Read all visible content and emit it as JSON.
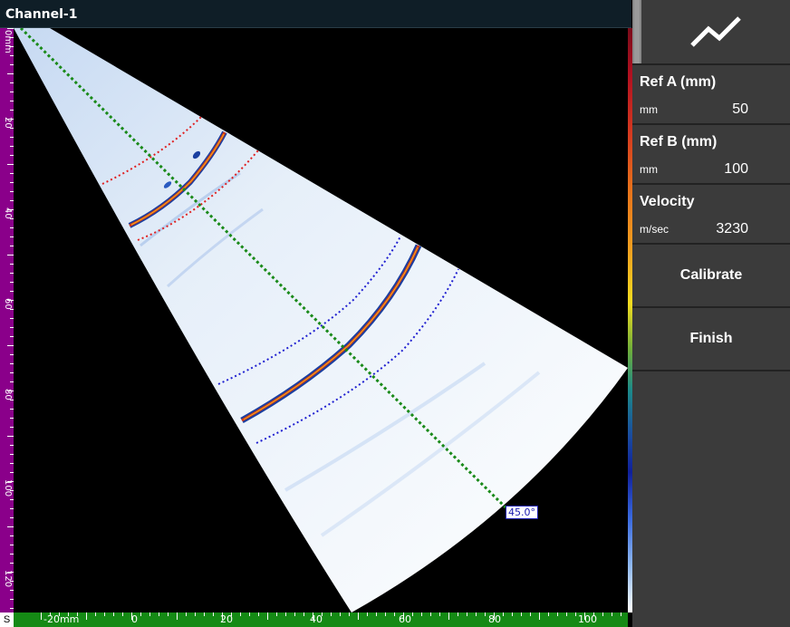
{
  "window": {
    "title": "Channel-1"
  },
  "left_ruler": {
    "unit_label": "0mm",
    "labels": [
      "20",
      "40",
      "60",
      "80",
      "100",
      "120"
    ]
  },
  "bottom_ruler": {
    "corner": "S",
    "labels": [
      "-20mm",
      "0",
      "20",
      "40",
      "60",
      "80",
      "100"
    ]
  },
  "scan": {
    "angle_label": "45.0°"
  },
  "panel": {
    "chart_icon": "line-chart-icon",
    "ref_a": {
      "name": "Ref A (mm)",
      "unit": "mm",
      "value": "50"
    },
    "ref_b": {
      "name": "Ref B (mm)",
      "unit": "mm",
      "value": "100"
    },
    "velocity": {
      "name": "Velocity",
      "unit": "m/sec",
      "value": "3230"
    },
    "calibrate_label": "Calibrate",
    "finish_label": "Finish"
  },
  "colors": {
    "ruler_left": "#8a008a",
    "ruler_bottom": "#158a15",
    "panel_bg": "#3b3b3b",
    "ref_a_gate": "#e02020",
    "ref_b_gate": "#2020d0",
    "angle_line": "#1a8a1a"
  }
}
